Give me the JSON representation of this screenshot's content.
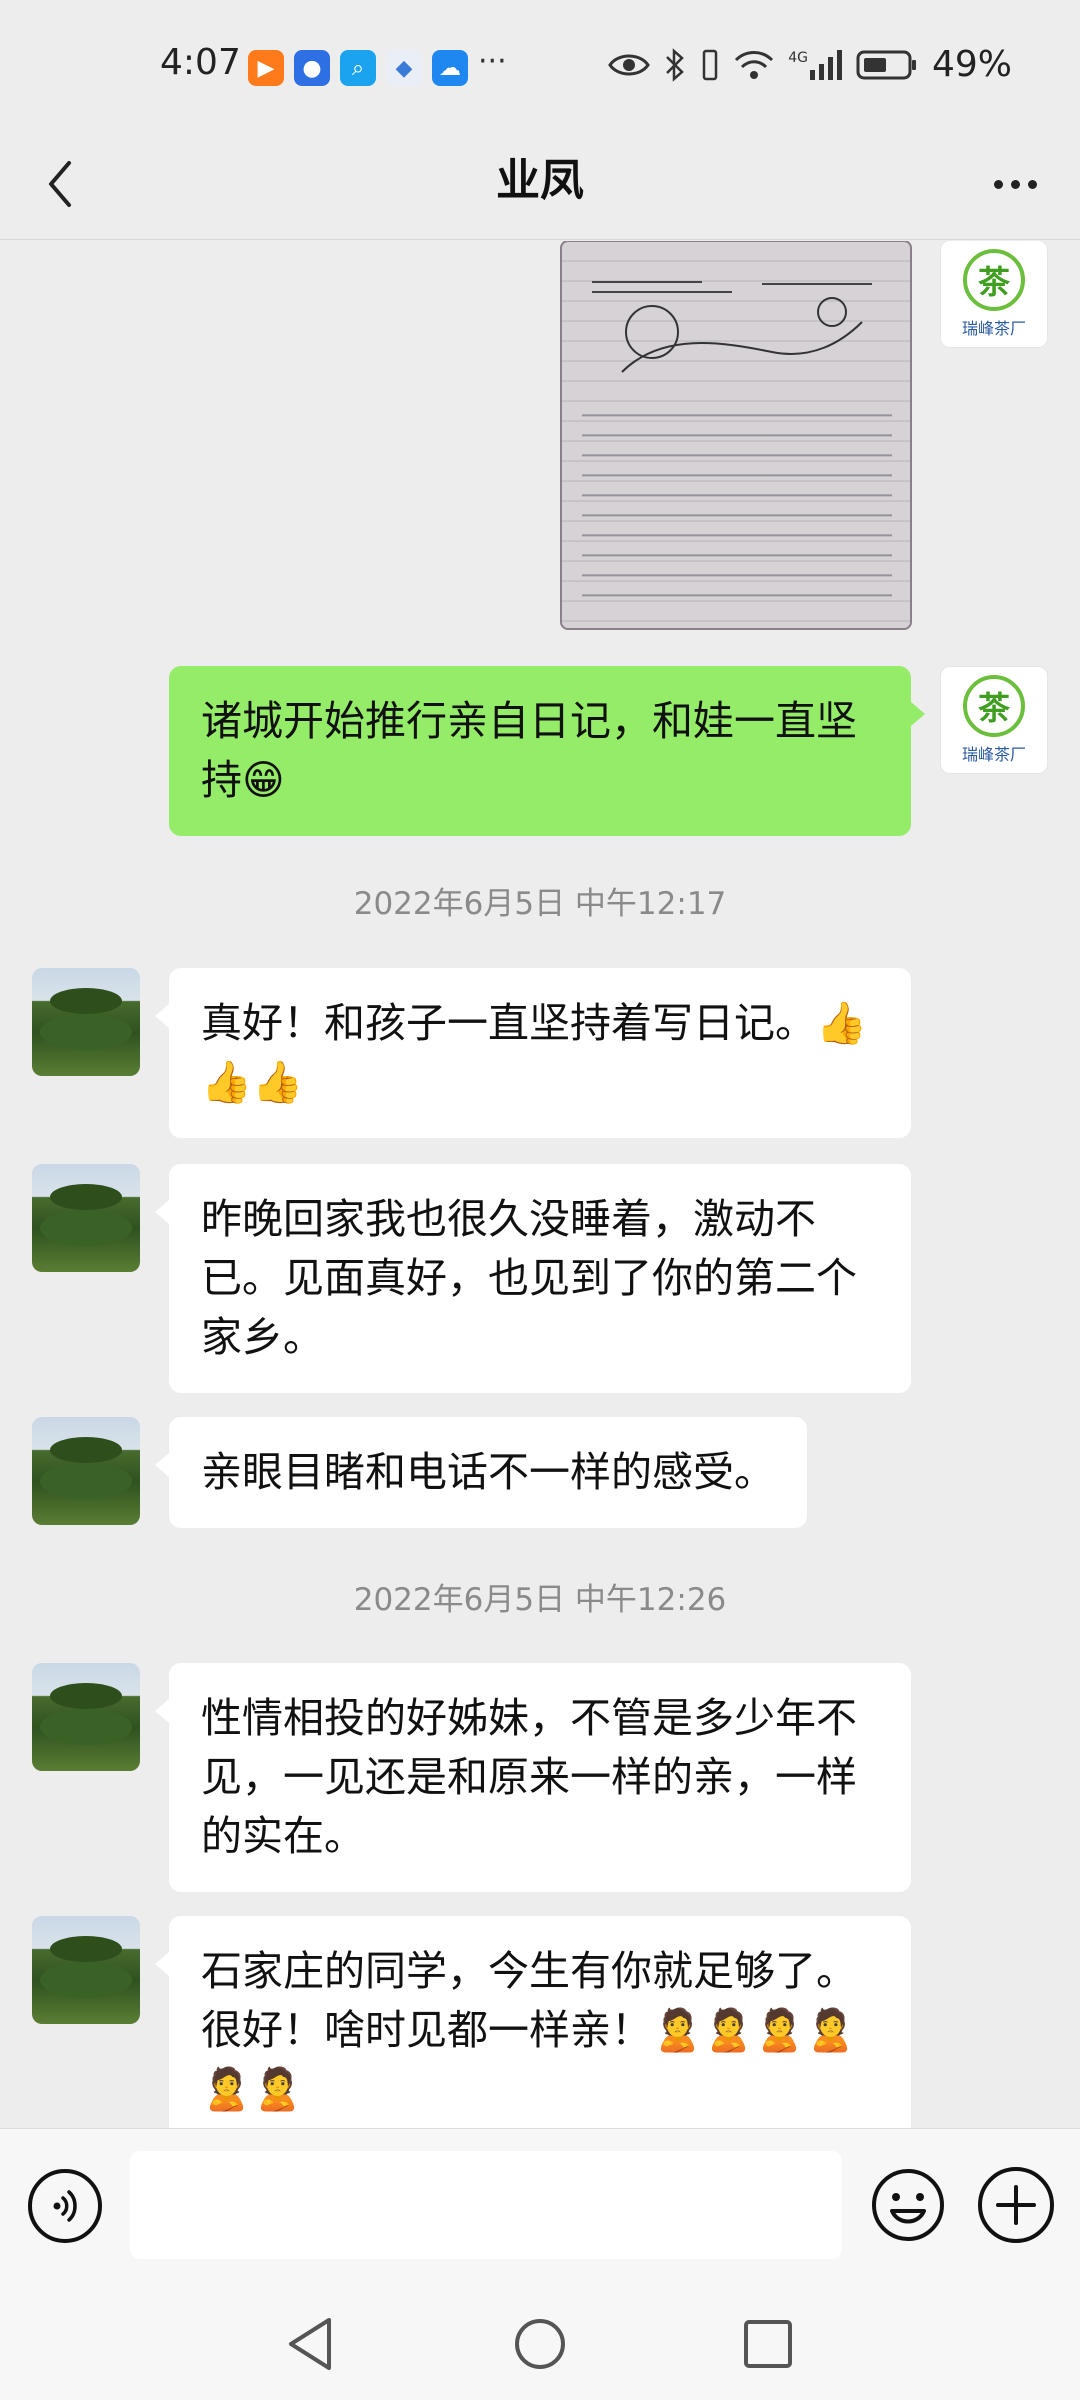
{
  "status_bar": {
    "time": "4:07",
    "more": "···",
    "network": "4G",
    "battery": "49%"
  },
  "header": {
    "title": "业凤"
  },
  "contacts": {
    "self_avatar_char": "茶",
    "self_avatar_label": "瑞峰茶厂"
  },
  "messages": [
    {
      "sender": "self",
      "type": "image"
    },
    {
      "sender": "self",
      "type": "text",
      "text": "诸城开始推行亲自日记，和娃一直坚持😁"
    },
    {
      "type": "timestamp",
      "text": "2022年6月5日 中午12:17"
    },
    {
      "sender": "other",
      "type": "text",
      "text": "真好！和孩子一直坚持着写日记。👍👍👍"
    },
    {
      "sender": "other",
      "type": "text",
      "text": "昨晚回家我也很久没睡着，激动不已。见面真好，也见到了你的第二个家乡。"
    },
    {
      "sender": "other",
      "type": "text",
      "text": "亲眼目睹和电话不一样的感受。"
    },
    {
      "type": "timestamp",
      "text": "2022年6月5日 中午12:26"
    },
    {
      "sender": "other",
      "type": "text",
      "text": "性情相投的好姊妹，不管是多少年不见，一见还是和原来一样的亲，一样的实在。"
    },
    {
      "sender": "other",
      "type": "text",
      "text": "石家庄的同学，今生有你就足够了。很好！啥时见都一样亲！🙎🙎🙎🙎🙎🙎"
    }
  ],
  "input": {
    "placeholder": ""
  },
  "colors": {
    "background": "#ededed",
    "self_bubble": "#95ec69",
    "other_bubble": "#ffffff",
    "timestamp": "#8a8a8a"
  }
}
